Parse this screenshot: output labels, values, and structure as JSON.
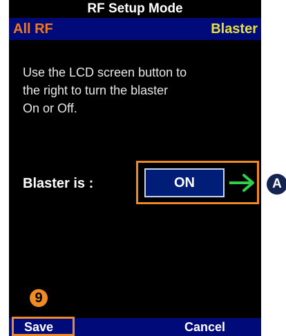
{
  "title": "RF Setup Mode",
  "header": {
    "left": "All RF",
    "right": "Blaster"
  },
  "instructions": [
    "Use the LCD screen button to",
    "the right to turn the blaster",
    "On or Off."
  ],
  "blaster": {
    "label": "Blaster is :",
    "state": "ON"
  },
  "callouts": {
    "a": "A",
    "nine": "9"
  },
  "softkeys": {
    "left": "Save",
    "right": "Cancel"
  },
  "colors": {
    "screen_bg": "#000000",
    "bar_blue": "#000a78",
    "accent_orange": "#f08a24",
    "blaster_yellow": "#e8e03c",
    "arrow_green": "#2fd04a",
    "marker_navy": "#14234f"
  }
}
